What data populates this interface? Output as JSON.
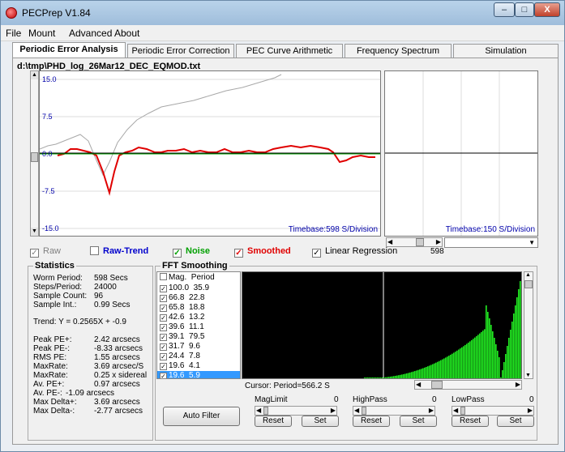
{
  "window": {
    "title": "PECPrep V1.84"
  },
  "window_buttons": {
    "minimize": "–",
    "maximize": "□",
    "close": "X"
  },
  "menu": [
    "File",
    "Mount",
    "Advanced",
    "About"
  ],
  "tabs": [
    {
      "label": "Periodic Error Analysis",
      "active": true
    },
    {
      "label": "Periodic Error Correction",
      "active": false
    },
    {
      "label": "PEC Curve Arithmetic",
      "active": false
    },
    {
      "label": "Frequency Spectrum",
      "active": false
    },
    {
      "label": "Simulation",
      "active": false
    }
  ],
  "file_path": "d:\\tmp\\PHD_log_26Mar12_DEC_EQMOD.txt",
  "main_chart": {
    "y_ticks": [
      "15.0",
      "7.5",
      "0.0",
      "-7.5",
      "-15.0"
    ],
    "timebase": "Timebase:598 S/Division"
  },
  "side_chart": {
    "timebase": "Timebase:150 S/Division",
    "scroll_value": "598"
  },
  "checks": [
    {
      "label": "Raw",
      "checked": true,
      "color": "#808080"
    },
    {
      "label": "Raw-Trend",
      "checked": false,
      "color": "#0000cc"
    },
    {
      "label": "Noise",
      "checked": true,
      "color": "#00a000"
    },
    {
      "label": "Smoothed",
      "checked": true,
      "color": "#e00000"
    },
    {
      "label": "Linear Regression",
      "checked": true,
      "color": "#000000"
    }
  ],
  "statistics": {
    "title": "Statistics",
    "rows": [
      {
        "label": "Worm Period:",
        "value": "598 Secs"
      },
      {
        "label": "Steps/Period:",
        "value": "24000"
      },
      {
        "label": "Sample Count:",
        "value": "96"
      },
      {
        "label": "Sample Int.:",
        "value": "0.99 Secs"
      }
    ],
    "trend": "Trend: Y = 0.2565X + -0.9",
    "pe_rows": [
      {
        "label": "Peak PE+:",
        "value": "2.42 arcsecs"
      },
      {
        "label": "Peak PE-:",
        "value": "-8.33 arcsecs"
      },
      {
        "label": "RMS PE:",
        "value": "1.55 arcsecs"
      },
      {
        "label": "MaxRate:",
        "value": "3.69 arcsec/S"
      },
      {
        "label": "MaxRate:",
        "value": "0.25 x sidereal"
      },
      {
        "label": "Av. PE+:",
        "value": "0.97 arcsecs"
      },
      {
        "label": "Av. PE-:",
        "value": "-1.09 arcsecs"
      },
      {
        "label": "Max Delta+:",
        "value": "3.69 arcsecs"
      },
      {
        "label": "Max Delta-:",
        "value": "-2.77 arcsecs"
      }
    ]
  },
  "fft": {
    "title": "FFT Smoothing",
    "header": {
      "mag": "Mag.",
      "period": "Period"
    },
    "rows": [
      {
        "mag": "100.0",
        "period": "35.9",
        "checked": true
      },
      {
        "mag": "66.8",
        "period": "22.8",
        "checked": true
      },
      {
        "mag": "65.8",
        "period": "18.8",
        "checked": true
      },
      {
        "mag": "42.6",
        "period": "13.2",
        "checked": true
      },
      {
        "mag": "39.6",
        "period": "11.1",
        "checked": true
      },
      {
        "mag": "39.1",
        "period": "79.5",
        "checked": true
      },
      {
        "mag": "31.7",
        "period": "9.6",
        "checked": true
      },
      {
        "mag": "24.4",
        "period": "7.8",
        "checked": true
      },
      {
        "mag": "19.6",
        "period": "4.1",
        "checked": true
      },
      {
        "mag": "19.6",
        "period": "5.9",
        "checked": true,
        "selected": true
      }
    ],
    "cursor": "Cursor: Period=566.2 S",
    "auto_filter": "Auto Filter"
  },
  "filters": [
    {
      "label": "MagLimit",
      "value": "0",
      "reset": "Reset",
      "set": "Set"
    },
    {
      "label": "HighPass",
      "value": "0",
      "reset": "Reset",
      "set": "Set"
    },
    {
      "label": "LowPass",
      "value": "0",
      "reset": "Reset",
      "set": "Set"
    }
  ]
}
